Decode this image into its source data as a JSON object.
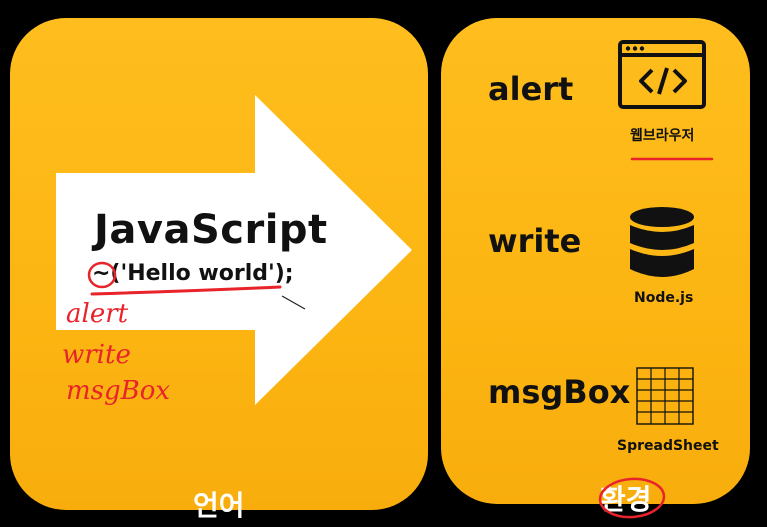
{
  "language": {
    "title": "JavaScript",
    "code": "~('Hello world');",
    "label": "언어",
    "handwritten_notes": [
      "alert",
      "write",
      "msgBox"
    ]
  },
  "environments": {
    "label": "환경",
    "items": [
      {
        "method": "alert",
        "caption": "웹브라우저",
        "icon": "code-window-icon"
      },
      {
        "method": "write",
        "caption": "Node.js",
        "icon": "database-icon"
      },
      {
        "method": "msgBox",
        "caption": "SpreadSheet",
        "icon": "grid-table-icon"
      }
    ]
  },
  "colors": {
    "background": "#000000",
    "panel": "#fdb816",
    "ink_red": "#e8232a",
    "text": "#111111"
  }
}
